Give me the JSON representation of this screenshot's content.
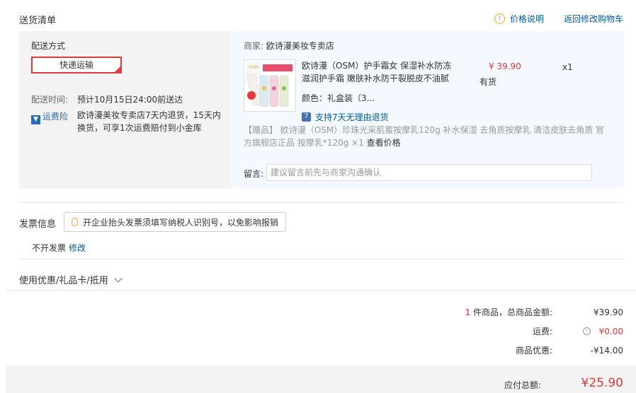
{
  "header": {
    "title": "送货清单",
    "price_info": "价格说明",
    "back_to_cart": "返回修改购物车"
  },
  "delivery": {
    "method_label": "配送方式",
    "method_value": "快递运输",
    "time_label": "配送时间:",
    "time_value": "预计10月15日24:00前送达",
    "insurance_badge": "运费险",
    "insurance_text": "欧诗漫美妆专卖店7天内退货，15天内换货，可享1次运费赔付到小金库"
  },
  "store": {
    "label": "商家:",
    "name": "欧诗漫美妆专卖店"
  },
  "product": {
    "title": "欧诗漫（OSM）护手霜女 保湿补水防冻滋润护手霜 嫩肤补水防干裂脱皮不油腻",
    "price": "¥ 39.90",
    "stock": "有货",
    "qty": "x1",
    "color": "颜色：礼盒装（3...",
    "return_policy": "支持7天无理由退货",
    "gift_text": "【赠品】 欧诗漫（OSM）珍珠光采肌蜜按摩乳120g 补水保湿 去角质按摩乳 清洁皮肤去角质 官方旗舰店正品 按摩乳*120g ×1",
    "gift_link": "查看价格",
    "message_label": "留言:",
    "message_placeholder": "建议留言前先与商家沟通确认"
  },
  "invoice": {
    "title": "发票信息",
    "tip": "开企业抬头发票须填写纳税人识别号，以免影响报销",
    "value": "不开发票",
    "edit": "修改"
  },
  "coupon": {
    "label": "使用优惠/礼品卡/抵用"
  },
  "summary": {
    "count": "1",
    "count_label": "件商品，总商品金额:",
    "goods_amount": "¥39.90",
    "freight_label": "运费:",
    "freight_value": "¥0.00",
    "discount_label": "商品优惠:",
    "discount_value": "-¥14.00",
    "total_label": "应付总额:",
    "total_value": "¥25.90"
  }
}
